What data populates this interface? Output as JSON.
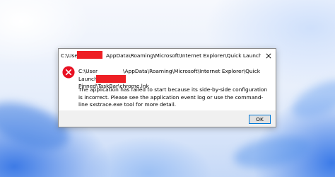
{
  "window": {
    "title": "C:\\Users\\[redacted]\\AppData\\Roaming\\Microsoft\\Internet Explorer\\Quick Launch\\User Pinn...",
    "title_prefix": "C:\\User",
    "title_suffix": "AppData\\Roaming\\Microsoft\\Internet Explorer\\Quick Launch\\User Pinn...",
    "close_icon": "close-icon"
  },
  "message": {
    "icon": "error-icon",
    "icon_color": "#e81123",
    "path_line1_prefix": "C:\\User",
    "path_line1_suffix": "\\AppData\\Roaming\\Microsoft\\Internet Explorer\\Quick Launch\\User",
    "path_line2": "Pinned\\TaskBar\\chrome.lnk",
    "body": "The application has failed to start because its side-by-side configuration is incorrect. Please see the application event log or use the command-line sxstrace.exe tool for more detail."
  },
  "buttons": {
    "ok_label": "OK"
  },
  "colors": {
    "redaction": "#ee1f24",
    "accent": "#0078d7"
  }
}
